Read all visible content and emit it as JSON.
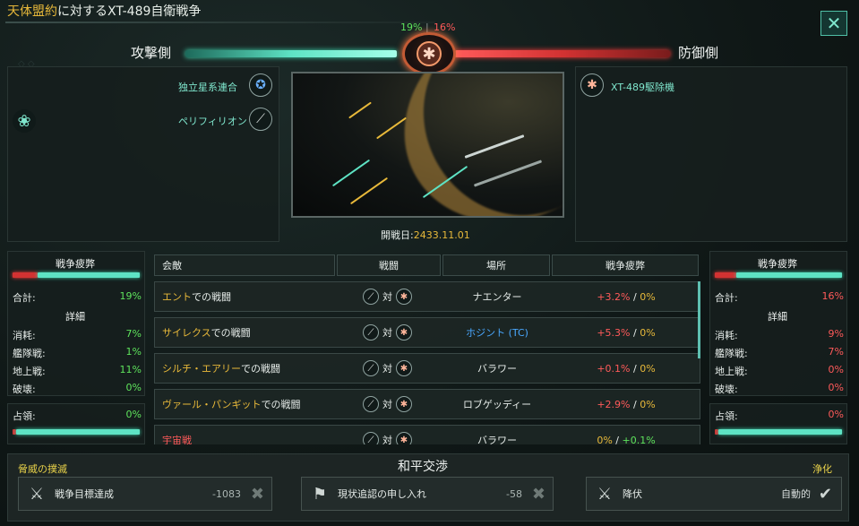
{
  "header": {
    "title_highlight": "天体盟約",
    "title_rest": "に対するXT-489自衛戦争",
    "close_icon": "close-icon"
  },
  "sides": {
    "attacker_label": "攻撃側",
    "defender_label": "防御側",
    "attacker_pct": "19%",
    "separator": "|",
    "defender_pct": "16%"
  },
  "attackers": [
    {
      "name": "独立星系連合",
      "icon": "federation-emblem-icon"
    },
    {
      "name": "ペリフィリオン",
      "icon": "blade-emblem-icon"
    }
  ],
  "defenders": [
    {
      "name": "XT-489駆除機",
      "icon": "machine-emblem-icon"
    }
  ],
  "battle_start": {
    "label": "開戦日:",
    "value": "2433.11.01"
  },
  "left_fatigue": {
    "title": "戦争疲弊",
    "total_label": "合計:",
    "total": "19%",
    "detail_title": "詳細",
    "rows": [
      {
        "label": "消耗:",
        "value": "7%"
      },
      {
        "label": "艦隊戦:",
        "value": "1%"
      },
      {
        "label": "地上戦:",
        "value": "11%"
      },
      {
        "label": "破壊:",
        "value": "0%"
      }
    ],
    "occupation_label": "占領:",
    "occupation": "0%"
  },
  "right_fatigue": {
    "title": "戦争疲弊",
    "total_label": "合計:",
    "total": "16%",
    "detail_title": "詳細",
    "rows": [
      {
        "label": "消耗:",
        "value": "9%"
      },
      {
        "label": "艦隊戦:",
        "value": "7%"
      },
      {
        "label": "地上戦:",
        "value": "0%"
      },
      {
        "label": "破壊:",
        "value": "0%"
      }
    ],
    "occupation_label": "占領:",
    "occupation": "0%"
  },
  "table": {
    "headers": [
      "会敵",
      "戦闘",
      "場所",
      "戦争疲弊"
    ],
    "vs": "対",
    "rows": [
      {
        "place_name": "エント",
        "suffix": "での戦闘",
        "location": "ナエンター",
        "plus": "+3.2%",
        "slash": "/",
        "zero": "0%"
      },
      {
        "place_name": "サイレクス",
        "suffix": "での戦闘",
        "location": "ホジント (TC)",
        "plus": "+5.3%",
        "slash": "/",
        "zero": "0%"
      },
      {
        "place_name": "シルチ・エアリー",
        "suffix": "での戦闘",
        "location": "バラワー",
        "plus": "+0.1%",
        "slash": "/",
        "zero": "0%"
      },
      {
        "place_name": "ヴァール・パンギット",
        "suffix": "での戦闘",
        "location": "ロブゲッディー",
        "plus": "+2.9%",
        "slash": "/",
        "zero": "0%"
      },
      {
        "place_name": "宇宙戦",
        "suffix": "",
        "location": "バラワー",
        "plus": "0%",
        "slash": "/",
        "zero": "+0.1%"
      }
    ]
  },
  "bottom": {
    "left_label": "脅威の撲滅",
    "center_title": "和平交渉",
    "right_label": "浄化",
    "options": [
      {
        "label": "戦争目標達成",
        "value": "-1083",
        "icon": "crossed-swords-icon"
      },
      {
        "label": "現状追認の申し入れ",
        "value": "-58",
        "icon": "handshake-icon"
      },
      {
        "label": "降伏",
        "value": "自動的",
        "icon": "surrender-swords-icon"
      }
    ]
  }
}
